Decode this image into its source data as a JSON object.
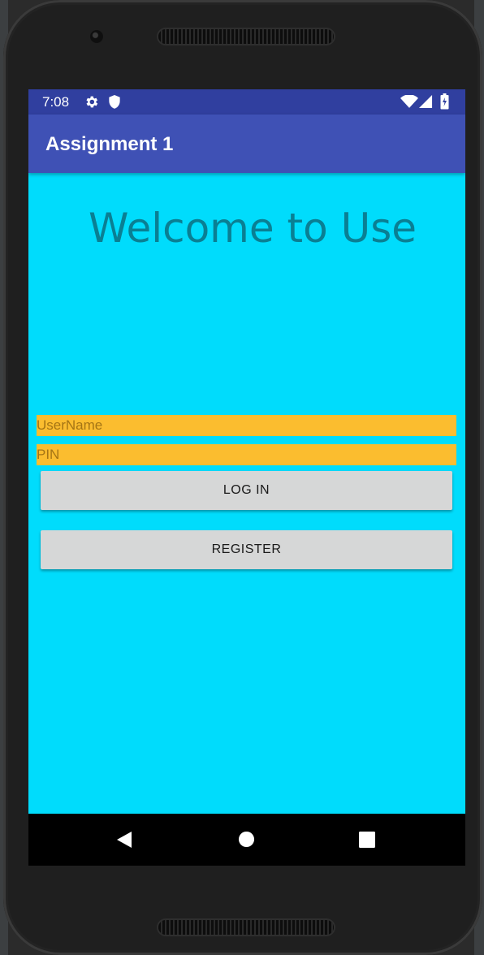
{
  "status_bar": {
    "time": "7:08",
    "left_icons": [
      "gear-icon",
      "shield-icon"
    ],
    "right_icons": [
      "wifi-icon",
      "signal-icon",
      "battery-icon"
    ]
  },
  "app_bar": {
    "title": "Assignment 1"
  },
  "main": {
    "welcome_text": "Welcome to Use",
    "username_placeholder": "UserName",
    "username_value": "",
    "pin_placeholder": "PIN",
    "pin_value": "",
    "login_label": "LOG IN",
    "register_label": "REGISTER"
  },
  "nav_bar": {
    "buttons": [
      "back-icon",
      "home-icon",
      "overview-icon"
    ]
  },
  "colors": {
    "status_bar": "#303f9f",
    "app_bar": "#3f51b5",
    "background": "#00dcfc",
    "input_background": "#fbbd2f",
    "button_background": "#d6d7d7",
    "welcome_text": "#0a7f93"
  }
}
